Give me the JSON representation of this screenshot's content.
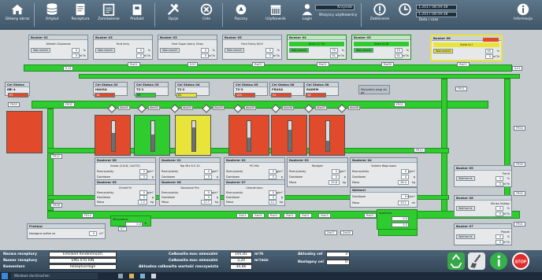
{
  "toolbar": {
    "buttons": [
      {
        "label": "Główny obraz",
        "icon": "home-icon"
      },
      {
        "label": "Artykuł",
        "icon": "database-icon"
      },
      {
        "label": "Receptura",
        "icon": "recipe-icon"
      },
      {
        "label": "Zamówienie",
        "icon": "order-icon"
      },
      {
        "label": "Produkt",
        "icon": "product-icon"
      },
      {
        "label": "Opcje",
        "icon": "tools-icon"
      },
      {
        "label": "Cele",
        "icon": "target-icon"
      },
      {
        "label": "Ręczny",
        "icon": "hand-icon"
      },
      {
        "label": "Użytkownik",
        "icon": "user-table-icon"
      },
      {
        "label": "Login",
        "icon": "login-icon"
      },
      {
        "label": "Wszyscy użytkownicy",
        "icon": "users-icon"
      },
      {
        "label": "Zakłócenie",
        "icon": "alert-icon"
      },
      {
        "label": "Data i czas",
        "icon": "clock-icon"
      },
      {
        "label": "Informacja",
        "icon": "info-icon"
      }
    ],
    "user_value": "Krzysiek",
    "datetime_1": "1.2017 08:59:38",
    "datetime_2": "1.2017 08:59:38"
  },
  "bunkers": [
    {
      "label": "Bunker 02",
      "name": "Wieletn Drozerow",
      "value": "0",
      "unit": "%"
    },
    {
      "label": "Bunker 03",
      "name": "Fent Ierry",
      "value": "0",
      "unit": "%"
    },
    {
      "label": "Bunker 03",
      "name": "Fent Super Joeny Olrey",
      "value": "0",
      "unit": "%"
    },
    {
      "label": "Bunker 05",
      "name": "Fent Fonty NCH",
      "value": "0",
      "unit": "%"
    },
    {
      "label": "Bunker 04",
      "name": "Kieta ICI 30",
      "value": "70",
      "unit": "%"
    },
    {
      "label": "Bunker 05",
      "name": "Kieta IV-IB",
      "value": "15",
      "unit": "%"
    },
    {
      "label": "Bunker 06",
      "name": "Kieta IV-I",
      "value": "45",
      "unit": "%"
    }
  ],
  "pipe_tags": [
    "IL14",
    "Rw01",
    "IL01",
    "Rw01",
    "Rw01",
    "Rw08",
    "Rw01",
    "IL01",
    "FR02",
    "FR03",
    "FR01",
    "FR04",
    "FR11",
    "FR12",
    "FR13",
    "FR08",
    "FR10",
    "FR09",
    "FR05",
    "FR01"
  ],
  "cells": [
    {
      "label": "Cel Status 07",
      "name": "Cel 4"
    },
    {
      "label": "Cel Status 02",
      "name": "HAUSA"
    },
    {
      "label": "Cel Status 03",
      "name": "T2-1"
    },
    {
      "label": "Cel Status 04",
      "name": "T2-2"
    },
    {
      "label": "Cel Status 05",
      "name": "T2-3"
    },
    {
      "label": "Cel Status 06",
      "name": "FRASA"
    },
    {
      "label": "Cel Status 08",
      "name": "RADEM"
    }
  ],
  "cell_values": [
    "93",
    "18",
    "53",
    "81",
    "100",
    "51",
    "26"
  ],
  "tank_levels": [
    0.6,
    0.55,
    0.8,
    0.45,
    0.7,
    0.35,
    0.5
  ],
  "valves": [
    "Abs01",
    "Abs02",
    "Abs03",
    "Abs04",
    "Abs05",
    "Abs06",
    "Abs07",
    "Abs08"
  ],
  "zasobnik_label": "Wszystkie plugi do gó",
  "dosing_panels": [
    {
      "label": "Dozierer 06",
      "name": "Kreda (CALB, CaCO3)",
      "rows": [
        [
          "Rzeczywisty",
          "0",
          "g/m²"
        ],
        [
          "Dozidowe",
          "0",
          "g"
        ],
        [
          "Masa",
          "12.8",
          "kg"
        ]
      ]
    },
    {
      "label": "Dozierer 01",
      "name": "Top Mix 6.5 10",
      "rows": [
        [
          "Rzeczywisty",
          "0",
          "g/m²"
        ],
        [
          "Dozidowe",
          "0",
          "g"
        ],
        [
          "Masa",
          "12.1",
          "kg"
        ]
      ]
    },
    {
      "label": "Dozierer 02",
      "name": "PG Mix",
      "rows": [
        [
          "Rzeczywisty",
          "0",
          "g/m²"
        ],
        [
          "Dozidowe",
          "0",
          "g"
        ],
        [
          "Masa",
          "21.8",
          "kg"
        ]
      ]
    },
    {
      "label": "Dozierer 03",
      "name": "Radigen",
      "rows": [
        [
          "Rzeczywisty",
          "0",
          "g/m²"
        ],
        [
          "Dozidowe",
          "0",
          "g"
        ],
        [
          "Masa",
          "29.8",
          "kg"
        ]
      ]
    },
    {
      "label": "Dozierer 04",
      "name": "Saletra Wapniowa",
      "rows": [
        [
          "Rzeczywisty",
          "0",
          "g/m²"
        ],
        [
          "Dozidowe",
          "0",
          "g"
        ],
        [
          "Masa",
          "28.4",
          "kg"
        ]
      ]
    },
    {
      "label": "Dozierer 05",
      "name": "Chelat Fe",
      "rows": [
        [
          "Rzeczywisty",
          "0",
          "g/m²"
        ],
        [
          "Dozidowe",
          "0",
          "g"
        ],
        [
          "Masa",
          "7.2",
          "kg"
        ]
      ]
    },
    {
      "label": "Dozierer 06",
      "name": "Dorozone Pro",
      "rows": [
        [
          "Rzeczywisty",
          "0",
          "g/m²"
        ],
        [
          "Dozidowe",
          "0",
          "g"
        ],
        [
          "Masa",
          "17.7",
          "kg"
        ]
      ]
    },
    {
      "label": "Dozierer 07",
      "name": "Ukorzeniacz",
      "rows": [
        [
          "Rzeczywisty",
          "0",
          "g/m²"
        ],
        [
          "Dozidowe",
          "0",
          "g"
        ],
        [
          "Masa",
          "12",
          "kg"
        ]
      ]
    }
  ],
  "wetness": {
    "label": "Wetnerl",
    "rows": [
      [
        "Dozidowe",
        "0",
        "ml/m²"
      ],
      [
        "Masa",
        "13.1",
        "ml"
      ]
    ]
  },
  "mieszalnik": {
    "label": "Mieszalnik",
    "value": "0.0",
    "unit": "%"
  },
  "przeplyw": {
    "label": "Przeływ",
    "row_label": "Nastąpne próbe za",
    "value": "0",
    "unit": "m³"
  },
  "bottom_valves": [
    "Zw01",
    "Zw04",
    "Rw01",
    "Zw01",
    "Zw01",
    "Zw03",
    "Zw07",
    "Zw08",
    "Rw01"
  ],
  "right_panels": [
    {
      "label": "Bunker 09",
      "name": "Perlit",
      "rows": [
        [
          "Wolframik",
          "0",
          "%"
        ],
        [
          "",
          "0",
          "m³/h"
        ]
      ]
    },
    {
      "label": "Bunker 08",
      "name": "Glinka Holday",
      "rows": [
        [
          "Wolframik",
          "0",
          "%"
        ],
        [
          "",
          "0",
          "m³/h"
        ]
      ]
    },
    {
      "label": "Bunker 07",
      "name": "Piasek",
      "rows": [
        [
          "Wolframik",
          "0",
          "%"
        ],
        [
          "",
          "0",
          "m³/h"
        ]
      ]
    }
  ],
  "spalanie": {
    "label": "Spalanie",
    "value": "0.0",
    "value2": "0.0"
  },
  "status": {
    "recipe_name_label": "Nazwa receptury",
    "recipe_name": "Emsland Rindenmulch",
    "recipe_number_label": "Numer receptury",
    "recipe_number": "EMS.070.RIN",
    "comment_label": "Komentarz",
    "comment": "Rezeptvorlage",
    "total_power_label_1": "Całkowita moc mieszalni",
    "total_power_1": "191,81",
    "total_power_unit_1": "m³/h",
    "total_power_label_2": "Całkowita moc mieszalni",
    "total_power_2": "3,20",
    "total_power_unit_2": "m³/min",
    "total_value_label": "Aktualna całkowita wartość rzeczywista",
    "total_value": "30,86",
    "current_target_label": "Aktualny cel",
    "current_target": "3",
    "next_target_label": "Następny cel",
    "next_target": "0"
  },
  "taskbar": {
    "start_label": "Windows durchsuchen"
  },
  "colors": {
    "toolbar": "#4a6275",
    "pipe": "#2ecc2e",
    "tank_red": "#e24a2c",
    "tank_yellow": "#e9e43a",
    "stop": "#e02c2c"
  }
}
